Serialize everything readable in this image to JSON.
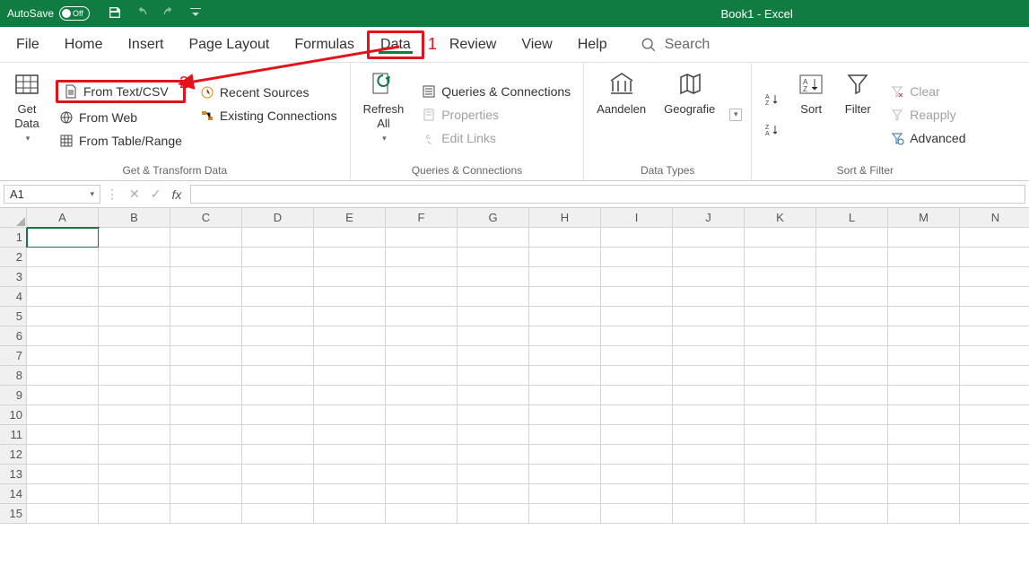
{
  "title": {
    "autosave": "AutoSave",
    "autosave_state": "Off",
    "document": "Book1  -  Excel"
  },
  "tabs": {
    "file": "File",
    "home": "Home",
    "insert": "Insert",
    "layout": "Page Layout",
    "formulas": "Formulas",
    "data": "Data",
    "review": "Review",
    "view": "View",
    "help": "Help",
    "search": "Search"
  },
  "annotations": {
    "one": "1",
    "two": "2"
  },
  "ribbon": {
    "get_transform": {
      "label": "Get & Transform Data",
      "get_data": "Get\nData",
      "from_text_csv": "From Text/CSV",
      "from_web": "From Web",
      "from_table": "From Table/Range",
      "recent_sources": "Recent Sources",
      "existing_conn": "Existing Connections"
    },
    "queries": {
      "label": "Queries & Connections",
      "refresh": "Refresh\nAll",
      "qc": "Queries & Connections",
      "props": "Properties",
      "edit_links": "Edit Links"
    },
    "data_types": {
      "label": "Data Types",
      "stocks": "Aandelen",
      "geo": "Geografie"
    },
    "sort_filter": {
      "label": "Sort & Filter",
      "sort": "Sort",
      "filter": "Filter",
      "clear": "Clear",
      "reapply": "Reapply",
      "advanced": "Advanced"
    }
  },
  "formula_bar": {
    "cell_ref": "A1",
    "fx": "fx"
  },
  "grid": {
    "cols": [
      "A",
      "B",
      "C",
      "D",
      "E",
      "F",
      "G",
      "H",
      "I",
      "J",
      "K",
      "L",
      "M",
      "N"
    ],
    "rows": [
      "1",
      "2",
      "3",
      "4",
      "5",
      "6",
      "7",
      "8",
      "9",
      "10",
      "11",
      "12",
      "13",
      "14",
      "15"
    ]
  }
}
